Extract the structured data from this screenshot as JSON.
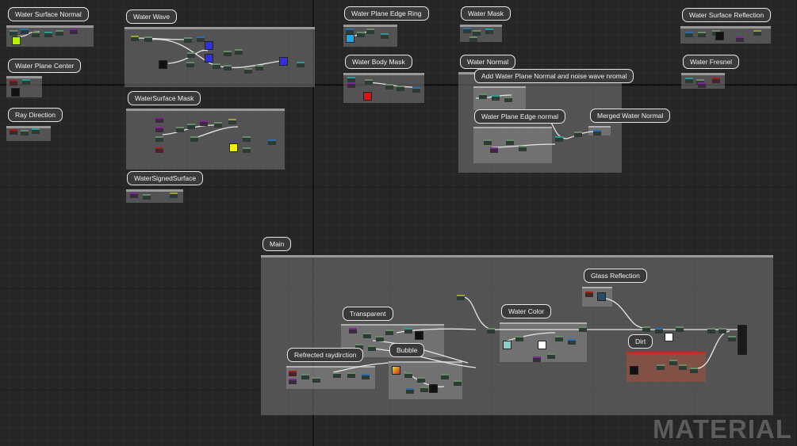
{
  "graph": {
    "groups": {
      "water_surface_normal": "Water Surface Normal",
      "water_plane_center": "Water Plane Center",
      "ray_direction": "Ray Direction",
      "water_wave": "Water Wave",
      "watersurface_mask": "WaterSurface Mask",
      "watersigned_surface": "WaterSignedSurface",
      "water_plane_edge_ring": "Water Plane Edge Ring",
      "water_body_mask": "Water Body Mask",
      "water_mask": "Water Mask",
      "water_normal": "Water Normal",
      "add_water_plane_normal": "Add Water Plane Normal and noise wave nromal",
      "water_plane_edge_normal": "Water Plane Edge normal",
      "merged_water_normal": "Merged Water Normal",
      "water_surface_reflection": "Water Surface Reflection",
      "water_fresnel": "Water Fresnel",
      "main": "Main",
      "glass_reflection": "Glass Reflection",
      "transparent": "Transparent",
      "water_color": "Water Color",
      "dirt": "Dirt",
      "refrected_raydirction": "Refrected raydirction",
      "bubble": "Bubble"
    },
    "watermark": "MATERIAL"
  },
  "colors": {
    "background": "#262626",
    "comment_box": "#787878",
    "dirt_box": "#aa503c",
    "wire": "#e6e6e6",
    "swatch_yellow_green": "#b8f000",
    "swatch_cyan": "#20a8e8",
    "swatch_red": "#e01010",
    "swatch_blue": "#3030e0",
    "swatch_yellow": "#f0f000",
    "swatch_white": "#ffffff"
  }
}
